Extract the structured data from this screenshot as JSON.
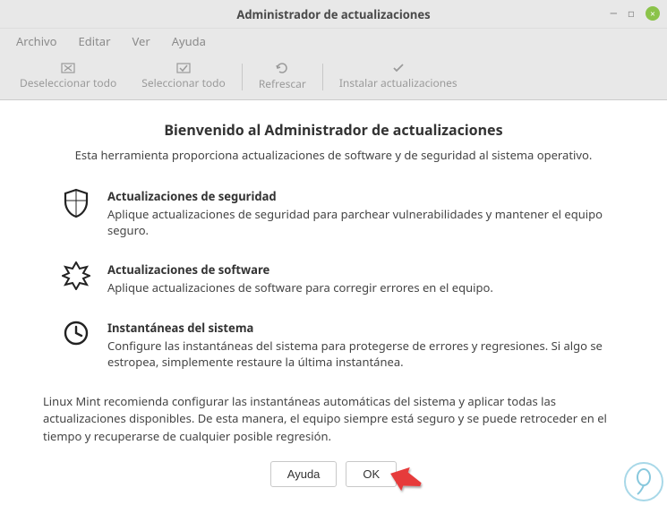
{
  "window": {
    "title": "Administrador de actualizaciones"
  },
  "menu": {
    "file": "Archivo",
    "edit": "Editar",
    "view": "Ver",
    "help": "Ayuda"
  },
  "toolbar": {
    "deselect_all": "Deseleccionar todo",
    "select_all": "Seleccionar todo",
    "refresh": "Refrescar",
    "install": "Instalar actualizaciones"
  },
  "welcome": {
    "title": "Bienvenido al Administrador de actualizaciones",
    "subtitle": "Esta herramienta proporciona actualizaciones de software y de seguridad al sistema operativo."
  },
  "features": {
    "security": {
      "title": "Actualizaciones de seguridad",
      "desc": "Aplique actualizaciones de seguridad para parchear vulnerabilidades y mantener el equipo seguro."
    },
    "software": {
      "title": "Actualizaciones de software",
      "desc": "Aplique actualizaciones de software para corregir errores en el equipo."
    },
    "snapshots": {
      "title": "Instantáneas del sistema",
      "desc": "Configure las instantáneas del sistema para protegerse de errores y regresiones. Si algo se estropea, simplemente restaure la última instantánea."
    }
  },
  "footer_note": "Linux Mint recomienda configurar las instantáneas automáticas del sistema y aplicar todas las actualizaciones disponibles. De esta manera, el equipo siempre está seguro y se puede retroceder en el tiempo y recuperarse de cualquier posible regresión.",
  "buttons": {
    "help": "Ayuda",
    "ok": "OK"
  }
}
